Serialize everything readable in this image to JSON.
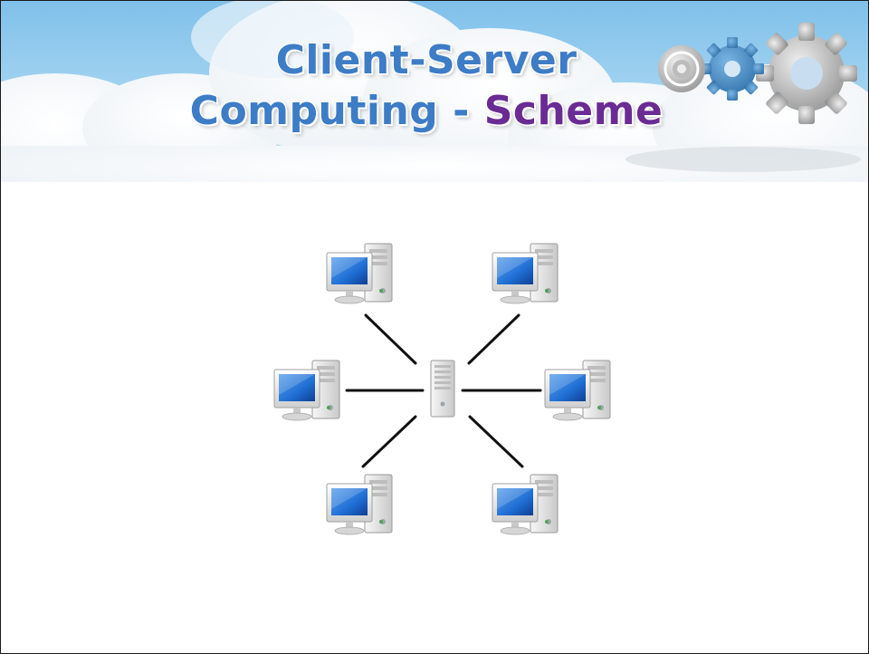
{
  "slide": {
    "title_line1": "Client-Server",
    "title_line2_main": "Computing - ",
    "title_line2_accent": "Scheme"
  },
  "colors": {
    "title_blue": "#3d7cc6",
    "title_purple": "#6a2b94",
    "sky": "#9fd2f0",
    "monitor_screen": "#1f6ed4"
  },
  "diagram": {
    "center": "server-icon",
    "clients": [
      "computer-icon",
      "computer-icon",
      "computer-icon",
      "computer-icon",
      "computer-icon",
      "computer-icon"
    ]
  },
  "decorations": [
    "cloud-background",
    "gears-icon"
  ]
}
